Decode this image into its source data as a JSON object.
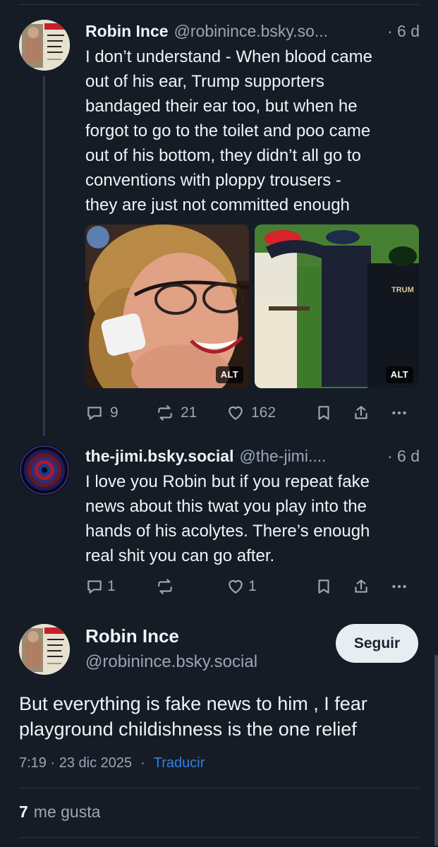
{
  "thread": [
    {
      "author": {
        "name": "Robin Ince",
        "handle": "@robinince.bsky.so...",
        "avatar": "book-cover-avatar"
      },
      "time": "· 6 d",
      "text_lines": [
        "I don’t understand - When blood came",
        "out of his ear, Trump supporters",
        "bandaged their ear too, but when he",
        "forgot to go to the toilet and poo came",
        "out of his bottom, they didn’t all go to",
        "conventions with ploppy trousers -",
        "they are just not committed enough"
      ],
      "images": [
        {
          "alt_label": "ALT",
          "subject": "smiling-woman-with-bandaged-ear-photo"
        },
        {
          "alt_label": "ALT",
          "subject": "golfers-walking-on-course-photo",
          "sign_text": "TRUM"
        }
      ],
      "actions": {
        "replies": "9",
        "reposts": "21",
        "likes": "162"
      }
    },
    {
      "author": {
        "name": "the-jimi.bsky.social",
        "handle": "@the-jimi....",
        "avatar": "concentric-circles-avatar"
      },
      "time": "· 6 d",
      "text_lines": [
        "I love you Robin but if you repeat fake",
        "news about this twat you play into the",
        "hands of his acolytes. There’s enough",
        "real shit you can go after."
      ],
      "actions": {
        "replies": "1",
        "reposts": "",
        "likes": "1"
      }
    }
  ],
  "focused_post": {
    "author": {
      "name": "Robin Ince",
      "handle": "@robinince.bsky.social",
      "avatar": "book-cover-avatar"
    },
    "follow_label": "Seguir",
    "text_lines": [
      "But everything is fake news to him , I fear",
      "playground childishness is the one relief"
    ],
    "timestamp": "7:19 · 23 dic 2025",
    "separator": "·",
    "translate_label": "Traducir",
    "likes_count": "7",
    "likes_label": "me gusta"
  },
  "colors": {
    "background": "#151c26",
    "text": "#f1f3f5",
    "muted": "#9aa6b6",
    "link": "#2f7fe6",
    "divider": "#2b3644",
    "follow_button_bg": "#e8edf2"
  }
}
